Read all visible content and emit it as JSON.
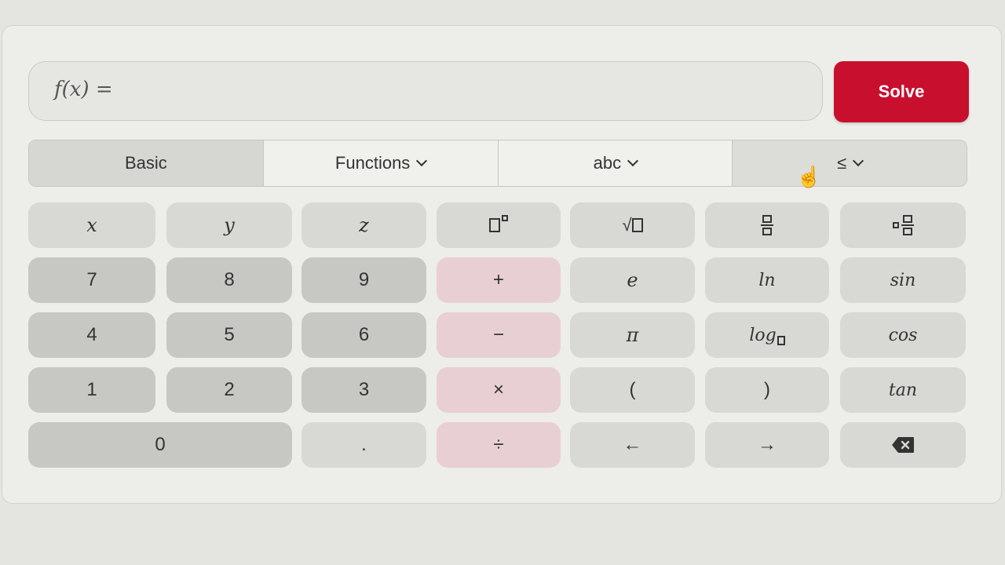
{
  "input": {
    "label": "f(x) ="
  },
  "solve": {
    "label": "Solve"
  },
  "tabs": [
    {
      "label": "Basic",
      "dropdown": false,
      "active": true
    },
    {
      "label": "Functions",
      "dropdown": true
    },
    {
      "label": "abc",
      "dropdown": true
    },
    {
      "label": "≤",
      "dropdown": true
    }
  ],
  "keys": {
    "x": "x",
    "y": "y",
    "z": "z",
    "d7": "7",
    "d8": "8",
    "d9": "9",
    "d4": "4",
    "d5": "5",
    "d6": "6",
    "d1": "1",
    "d2": "2",
    "d3": "3",
    "d0": "0",
    "dot": ".",
    "plus": "+",
    "minus": "−",
    "times": "×",
    "divide": "÷",
    "e": "e",
    "pi": "π",
    "lparen": "(",
    "rparen": ")",
    "left": "←",
    "right": "→",
    "ln": "ln",
    "log": "log",
    "sin": "sin",
    "cos": "cos",
    "tan": "tan"
  },
  "icons": {
    "superscript": "square-superscript-icon",
    "sqrt": "square-root-icon",
    "fraction": "fraction-icon",
    "mixed_fraction": "mixed-fraction-icon",
    "backspace": "backspace-icon",
    "cursor": "hand-pointer-icon"
  },
  "colors": {
    "accent": "#c8102e",
    "operator": "#e8cfd3"
  }
}
